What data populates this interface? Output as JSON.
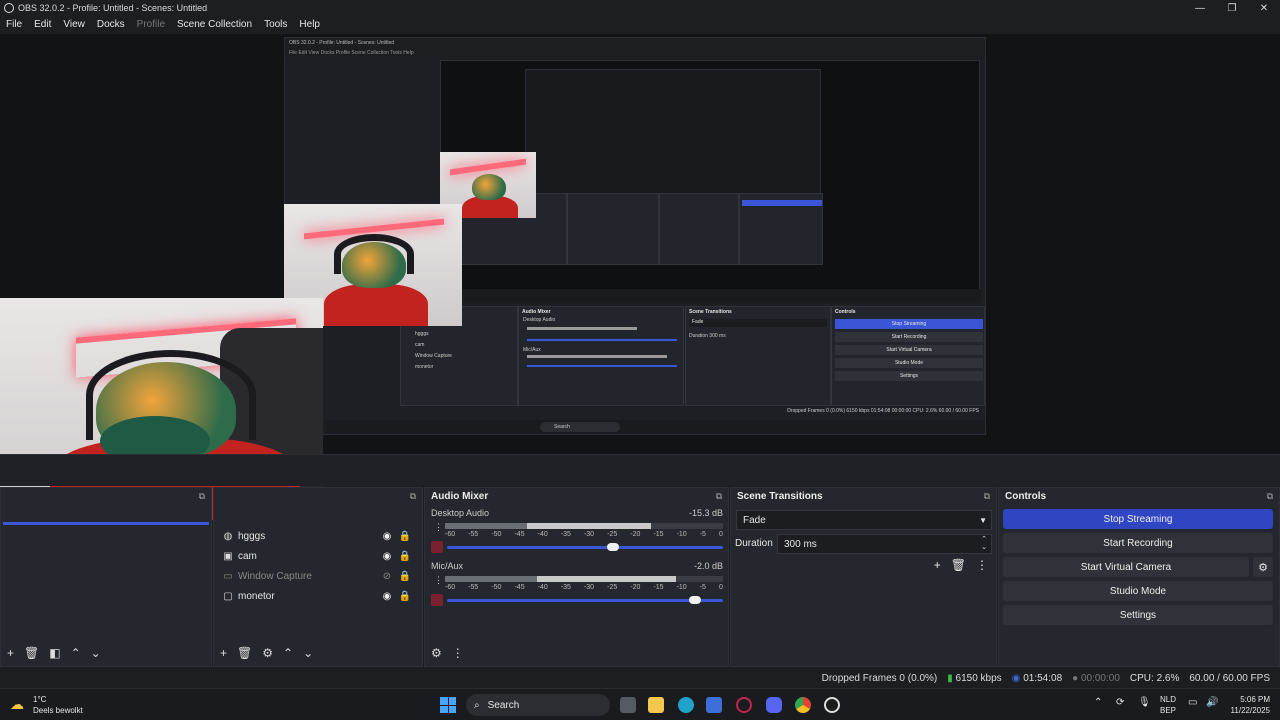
{
  "window": {
    "title": "OBS 32.0.2 - Profile: Untitled - Scenes: Untitled",
    "min": "—",
    "max": "❐",
    "close": "✕"
  },
  "menu": [
    {
      "label": "File",
      "enabled": true
    },
    {
      "label": "Edit",
      "enabled": true
    },
    {
      "label": "View",
      "enabled": true
    },
    {
      "label": "Docks",
      "enabled": true
    },
    {
      "label": "Profile",
      "enabled": false
    },
    {
      "label": "Scene Collection",
      "enabled": true
    },
    {
      "label": "Tools",
      "enabled": true
    },
    {
      "label": "Help",
      "enabled": true
    }
  ],
  "inner_preview": {
    "title": "OBS 32.0.2 - Profile: Untitled - Scenes: Untitled",
    "menu": "File  Edit  View  Docks  Profile  Scene Collection  Tools  Help",
    "panels": {
      "audio": "Audio Mixer",
      "transitions": "Scene Transitions",
      "controls": "Controls"
    },
    "taskbar_search": "Search",
    "sources": [
      "hgggs",
      "cam",
      "Window Capture",
      "monetor"
    ],
    "fade": "Fade",
    "duration": "Duration",
    "duration_value": "300 ms",
    "desktop_audio": "Desktop Audio",
    "mic": "Mic/Aux",
    "buttons": [
      "Stop Streaming",
      "Start Recording",
      "Start Virtual Camera",
      "Studio Mode",
      "Settings"
    ],
    "status": "Dropped Frames 0 (0.0%)   6150 kbps   01:54:08   00:00:00   CPU: 2.6%   60.00 / 60.00 FPS"
  },
  "sources": {
    "items": [
      {
        "name": "hgggs",
        "icon": "globe-icon",
        "hidden": false
      },
      {
        "name": "cam",
        "icon": "camera-icon",
        "hidden": false
      },
      {
        "name": "Window Capture",
        "icon": "window-icon",
        "hidden": true
      },
      {
        "name": "monetor",
        "icon": "monitor-icon",
        "hidden": false
      }
    ]
  },
  "audio_mixer": {
    "title": "Audio Mixer",
    "channels": [
      {
        "name": "Desktop Audio",
        "db": "-15.3 dB",
        "level": 0.74,
        "volume": 0.6
      },
      {
        "name": "Mic/Aux",
        "db": "-2.0 dB",
        "level": 0.83,
        "volume": 0.9
      }
    ],
    "ticks": [
      "-60",
      "-55",
      "-50",
      "-45",
      "-40",
      "-35",
      "-30",
      "-25",
      "-20",
      "-15",
      "-10",
      "-5",
      "0"
    ]
  },
  "scene_transitions": {
    "title": "Scene Transitions",
    "transition": "Fade",
    "duration_label": "Duration",
    "duration_value": "300 ms"
  },
  "controls": {
    "title": "Controls",
    "stop_streaming": "Stop Streaming",
    "start_recording": "Start Recording",
    "start_virtual_camera": "Start Virtual Camera",
    "studio_mode": "Studio Mode",
    "settings": "Settings"
  },
  "status": {
    "dropped": "Dropped Frames 0 (0.0%)",
    "bitrate": "6150 kbps",
    "stream_time": "01:54:08",
    "rec_time": "00:00:00",
    "cpu": "CPU: 2.6%",
    "fps": "60.00 / 60.00 FPS"
  },
  "taskbar": {
    "weather_temp": "1°C",
    "weather_text": "Deels bewolkt",
    "search": "Search",
    "lang": "NLD",
    "lang2": "BEP",
    "time": "5:06 PM",
    "date": "11/22/2025"
  },
  "colors": {
    "accent": "#3a55d6",
    "bg": "#1c1e22",
    "panel": "#24272d"
  }
}
